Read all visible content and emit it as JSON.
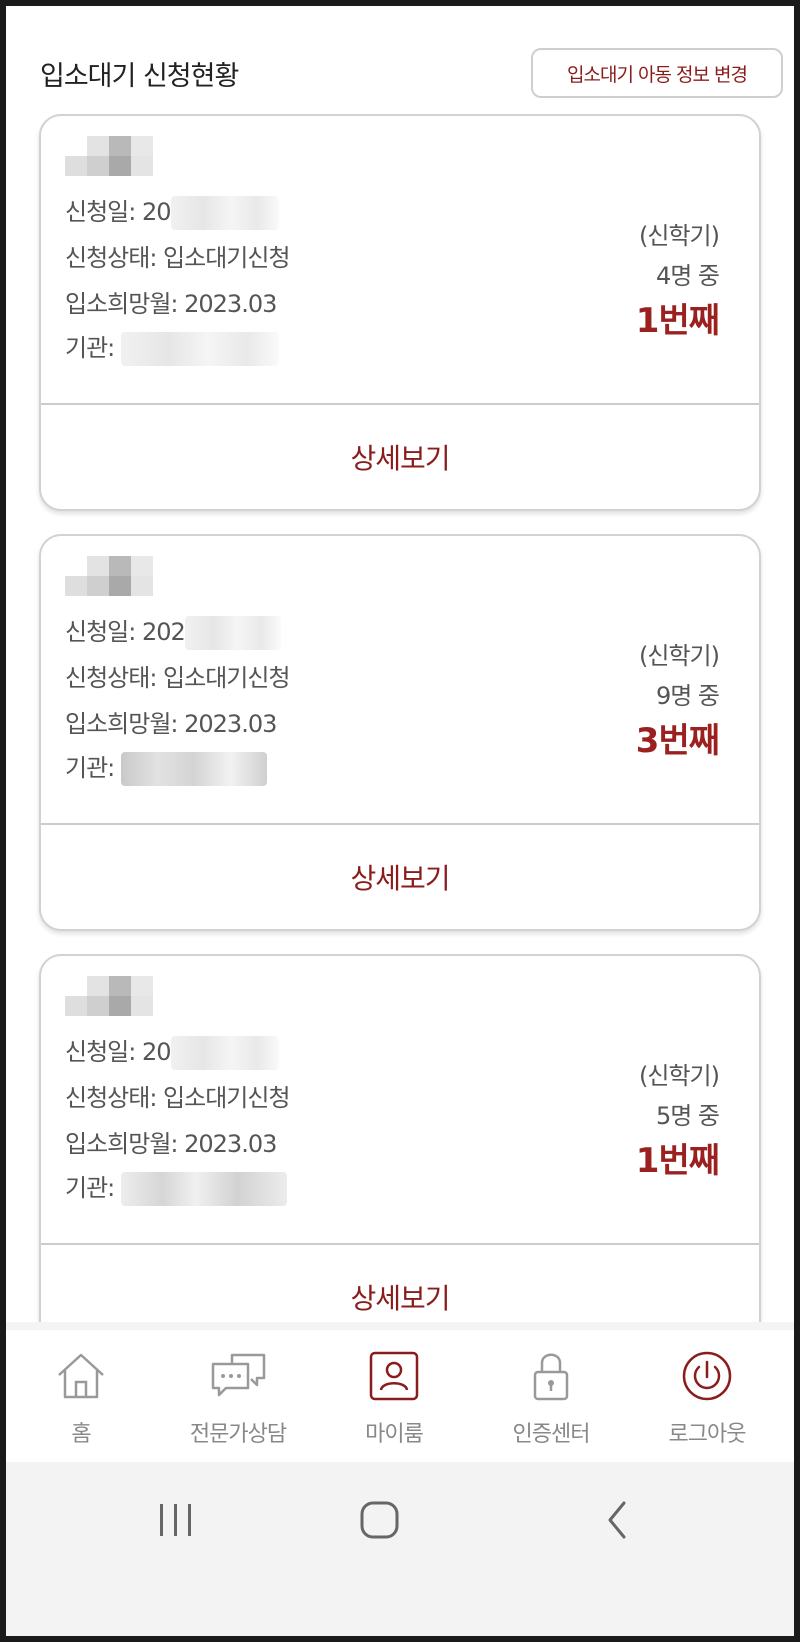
{
  "header": {
    "title": "입소대기 신청현황",
    "change_button": "입소대기 아동 정보 변경"
  },
  "labels": {
    "apply_date": "신청일: ",
    "status": "신청상태: ",
    "desired_month": "입소희망월: ",
    "institution": "기관: "
  },
  "cards": [
    {
      "date_prefix": "20",
      "status": "입소대기신청",
      "desired_month": "2023.03",
      "semester": "(신학기)",
      "count": "4명 중",
      "rank": "1번째",
      "detail": "상세보기"
    },
    {
      "date_prefix": "202",
      "status": "입소대기신청",
      "desired_month": "2023.03",
      "semester": "(신학기)",
      "count": "9명 중",
      "rank": "3번째",
      "detail": "상세보기"
    },
    {
      "date_prefix": "20",
      "status": "입소대기신청",
      "desired_month": "2023.03",
      "semester": "(신학기)",
      "count": "5명 중",
      "rank": "1번째",
      "detail": "상세보기"
    }
  ],
  "nav": {
    "items": [
      {
        "label": "홈",
        "icon": "home-icon"
      },
      {
        "label": "전문가상담",
        "icon": "chat-icon"
      },
      {
        "label": "마이룸",
        "icon": "user-icon"
      },
      {
        "label": "인증센터",
        "icon": "lock-icon"
      },
      {
        "label": "로그아웃",
        "icon": "power-icon"
      }
    ]
  },
  "colors": {
    "accent": "#8b1c1c",
    "rank": "#9b2020",
    "text": "#555555"
  }
}
